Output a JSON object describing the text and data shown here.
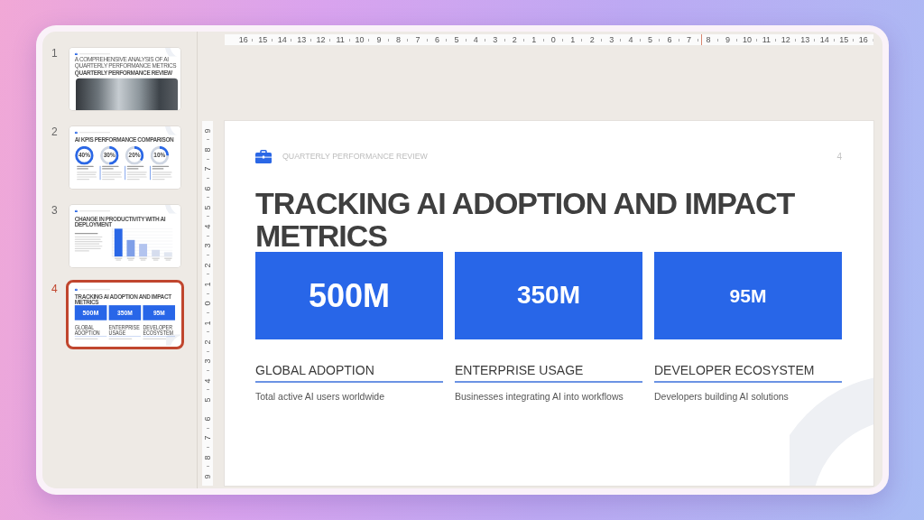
{
  "slides_panel": {
    "thumbnails": [
      {
        "number": "1",
        "selected": false,
        "kind": "title",
        "subtitle": "A COMPREHENSIVE ANALYSIS OF AI QUARTERLY PERFORMANCE METRICS",
        "title": "QUARTERLY PERFORMANCE REVIEW"
      },
      {
        "number": "2",
        "selected": false,
        "kind": "kpis",
        "title": "AI KPIS PERFORMANCE COMPARISON",
        "rings": [
          {
            "value": "40%",
            "level": 1
          },
          {
            "value": "30%",
            "level": 0.5
          },
          {
            "value": "20%",
            "level": 0.35
          },
          {
            "value": "10%",
            "level": 0.25
          }
        ]
      },
      {
        "number": "3",
        "selected": false,
        "kind": "chart",
        "title": "CHANGE IN PRODUCTIVITY WITH AI DEPLOYMENT"
      },
      {
        "number": "4",
        "selected": true,
        "kind": "metrics",
        "title": "TRACKING AI ADOPTION AND IMPACT METRICS",
        "metrics": [
          {
            "value": "500M",
            "label": "GLOBAL ADOPTION"
          },
          {
            "value": "350M",
            "label": "ENTERPRISE USAGE"
          },
          {
            "value": "95M",
            "label": "DEVELOPER ECOSYSTEM"
          }
        ]
      }
    ]
  },
  "rulers": {
    "horizontal": [
      "16",
      "15",
      "14",
      "13",
      "12",
      "11",
      "10",
      "9",
      "8",
      "7",
      "6",
      "5",
      "4",
      "3",
      "2",
      "1",
      "0",
      "1",
      "2",
      "3",
      "4",
      "5",
      "6",
      "7",
      "8",
      "9",
      "10",
      "11",
      "12",
      "13",
      "14",
      "15",
      "16"
    ],
    "vertical": [
      "9",
      "8",
      "7",
      "6",
      "5",
      "4",
      "3",
      "2",
      "1",
      "0",
      "1",
      "2",
      "3",
      "4",
      "5",
      "6",
      "7",
      "8",
      "9"
    ]
  },
  "slide": {
    "header": "QUARTERLY PERFORMANCE REVIEW",
    "page_number": "4",
    "title": "TRACKING AI ADOPTION AND IMPACT METRICS",
    "metrics": [
      {
        "value": "500M",
        "label": "GLOBAL ADOPTION",
        "description": "Total active AI users worldwide"
      },
      {
        "value": "350M",
        "label": "ENTERPRISE USAGE",
        "description": "Businesses integrating AI into workflows"
      },
      {
        "value": "95M",
        "label": "DEVELOPER ECOSYSTEM",
        "description": "Developers building AI solutions"
      }
    ]
  }
}
